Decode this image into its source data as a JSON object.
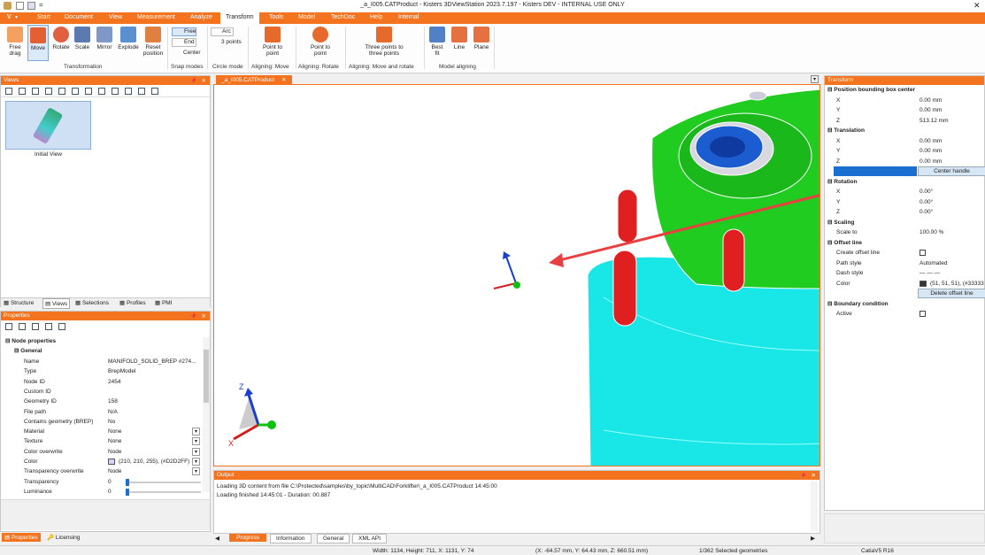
{
  "title_bar": {
    "file_label": "_a_I005.CATProduct - Kisters 3DViewStation 2023.7.197 - Kisters DEV - INTERNAL USE ONLY",
    "close_icon": "close-icon"
  },
  "menu": {
    "logo": "V",
    "items": [
      "Start",
      "Document",
      "View",
      "Measurement",
      "Analyze",
      "Transform",
      "Tools",
      "Model",
      "TechDoc",
      "Help",
      "Internal"
    ],
    "active": "Transform"
  },
  "ribbon": {
    "buttons": [
      {
        "label": "Free\ndrag"
      },
      {
        "label": "Move"
      },
      {
        "label": "Rotate"
      },
      {
        "label": "Scale"
      },
      {
        "label": "Mirror"
      },
      {
        "label": "Explode"
      },
      {
        "label": "Reset\nposition"
      }
    ],
    "group_transformation": "Transformation",
    "snap": {
      "free": "Free",
      "end": "End",
      "center": "Center",
      "label": "Snap modes"
    },
    "circle": {
      "arc": "Arc",
      "three": "3 points",
      "label": "Circle mode"
    },
    "align_move": {
      "btn": "Point to\npoint",
      "label": "Aligning: Move"
    },
    "align_rotate": {
      "btn": "Point to\npoint",
      "label": "Aligning: Rotate"
    },
    "three_points": {
      "btn": "Three points to\nthree points",
      "label": "Aligning: Move and rotate"
    },
    "model_align": {
      "best": "Best\nfit",
      "line": "Line",
      "plane": "Plane",
      "label": "Model aligning"
    }
  },
  "views_panel": {
    "title": "Views",
    "thumb_label": "Initial View",
    "tabs": [
      "Structure",
      "Views",
      "Selections",
      "Profiles",
      "PMI"
    ]
  },
  "properties_panel": {
    "title": "Properties",
    "node_props": "Node properties",
    "general": "General",
    "rows": [
      [
        "Name",
        "MANIFOLD_SOLID_BREP #274..."
      ],
      [
        "Type",
        "BrepModel"
      ],
      [
        "Node ID",
        "2454"
      ],
      [
        "Custom ID",
        ""
      ],
      [
        "Geometry ID",
        "158"
      ],
      [
        "File path",
        "N/A"
      ],
      [
        "Contains geometry (BREP)",
        "No"
      ],
      [
        "Material",
        "None"
      ],
      [
        "Texture",
        "None"
      ],
      [
        "Color overwrite",
        "Node"
      ],
      [
        "Color",
        "(210, 210, 255), (#D2D2FF)"
      ],
      [
        "Transparency overwrite",
        "Node"
      ],
      [
        "Transparency",
        "0"
      ],
      [
        "Luminance",
        "0"
      ]
    ],
    "bottom_tabs": [
      "Properties",
      "Licensing"
    ]
  },
  "doc_tab": "_a_I005.CATProduct",
  "output": {
    "title": "Output",
    "lines": [
      "Loading 3D content from file C:\\Protected\\samples\\by_topic\\MultiCAD\\Forklifter\\_a_I005.CATProduct 14:45:00",
      "Loading finished 14:45:01 - Duration: 00.887"
    ],
    "tabs": [
      "Progress",
      "Information",
      "General",
      "XML API"
    ]
  },
  "transform_panel": {
    "title": "Transform",
    "sections": [
      {
        "name": "Position bounding box center",
        "rows": [
          [
            "X",
            "0.00 mm"
          ],
          [
            "Y",
            "0.00 mm"
          ],
          [
            "Z",
            "513.12 mm"
          ]
        ]
      },
      {
        "name": "Translation",
        "rows": [
          [
            "X",
            "0.00 mm"
          ],
          [
            "Y",
            "0.00 mm"
          ],
          [
            "Z",
            "0.00 mm"
          ]
        ],
        "button": "Center handle"
      },
      {
        "name": "Rotation",
        "rows": [
          [
            "X",
            "0.00°"
          ],
          [
            "Y",
            "0.00°"
          ],
          [
            "Z",
            "0.00°"
          ]
        ]
      },
      {
        "name": "Scaling",
        "rows": [
          [
            "Scale to",
            "100.00 %"
          ]
        ]
      },
      {
        "name": "Offset line",
        "rows": [
          [
            "Create offset line",
            ""
          ],
          [
            "Path style",
            "Automated"
          ],
          [
            "Dash style",
            "— — —"
          ],
          [
            "Color",
            "(51, 51, 51), (#33333"
          ]
        ],
        "button": "Delete offset line"
      },
      {
        "name": "Boundary condition",
        "rows": [
          [
            "Active",
            ""
          ]
        ]
      }
    ]
  },
  "status_bar": {
    "dims": "Width: 1134, Height: 711, X: 1131, Y: 74",
    "coords": "(X: -64.57 mm, Y: 64.43 mm, Z: 660.51 mm)",
    "selection": "1/362 Selected geometries",
    "format": "CatiaV5 R16"
  },
  "colors": {
    "accent": "#f3731e",
    "selection": "#1a6fd0"
  }
}
